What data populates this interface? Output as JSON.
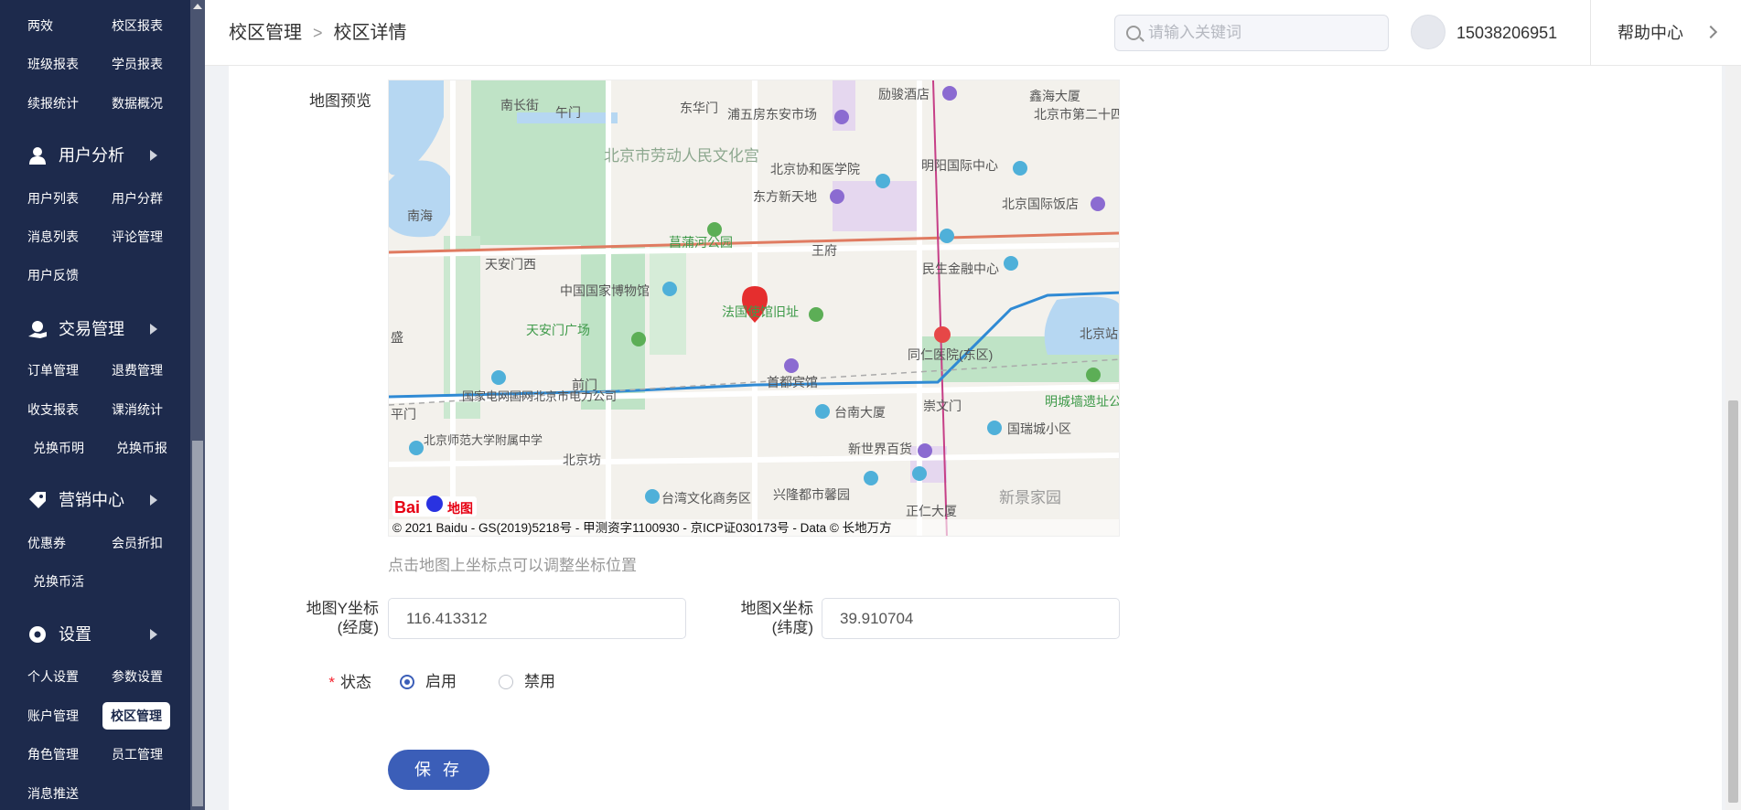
{
  "sidebar": {
    "top_items": [
      {
        "left": "两效",
        "right": "校区报表"
      },
      {
        "left": "班级报表",
        "right": "学员报表"
      },
      {
        "left": "续报统计",
        "right": "数据概况"
      }
    ],
    "groups": [
      {
        "label": "用户分析",
        "icon": "user-icon",
        "items": [
          [
            "用户列表",
            "用户分群"
          ],
          [
            "消息列表",
            "评论管理"
          ],
          [
            "用户反馈",
            ""
          ]
        ]
      },
      {
        "label": "交易管理",
        "icon": "money-icon",
        "items": [
          [
            "订单管理",
            "退费管理"
          ],
          [
            "收支报表",
            "课消统计"
          ],
          [
            "兑换币明",
            "兑换币报"
          ]
        ]
      },
      {
        "label": "营销中心",
        "icon": "tag-icon",
        "items": [
          [
            "优惠券",
            "会员折扣"
          ],
          [
            "兑换币活",
            ""
          ]
        ]
      },
      {
        "label": "设置",
        "icon": "gear-icon",
        "items": [
          [
            "个人设置",
            "参数设置"
          ],
          [
            "账户管理",
            "校区管理"
          ],
          [
            "角色管理",
            "员工管理"
          ],
          [
            "消息推送",
            ""
          ]
        ]
      }
    ],
    "active": "校区管理"
  },
  "header": {
    "breadcrumb": [
      "校区管理",
      "校区详情"
    ],
    "search_placeholder": "请输入关键词",
    "phone": "15038206951",
    "help": "帮助中心"
  },
  "form": {
    "map_label": "地图预览",
    "map": {
      "copyright": "© 2021 Baidu - GS(2019)5218号 - 甲测资字1100930 - 京ICP证030173号 - Data © 长地万方",
      "logo_text": "Bai",
      "logo_text2": "地图",
      "places": [
        "午门",
        "东华门",
        "南长街",
        "北京市劳动人民文化宫",
        "浦五房东安市场",
        "励骏酒店",
        "鑫海大厦",
        "北京市第二十四中学",
        "北京协和医学院",
        "明阳国际中心",
        "东方新天地",
        "北京国际饭店",
        "南海",
        "菖蒲河公园",
        "天安门西",
        "王府",
        "民生金融中心",
        "中国国家博物馆",
        "法国使馆旧址",
        "天安门广场",
        "同仁医院(东区)",
        "北京站",
        "国家电网国网北京市电力公司",
        "前门",
        "首都宾馆",
        "崇文门",
        "明城墙遗址公",
        "台南大厦",
        "国瑞城小区",
        "北京师范大学附属中学",
        "新世界百货",
        "北京坊",
        "台湾文化商务区",
        "兴隆都市馨园",
        "正仁大厦",
        "新景家园",
        "平门",
        "盛"
      ]
    },
    "map_hint": "点击地图上坐标点可以调整坐标位置",
    "lng_label": "地图Y坐标(经度)",
    "lng_label_line1": "地图Y坐标",
    "lng_label_line2": "(经度)",
    "lng_value": "116.413312",
    "lat_label_line1": "地图X坐标",
    "lat_label_line2": "(纬度)",
    "lat_value": "39.910704",
    "status_label": "状态",
    "status_options": [
      "启用",
      "禁用"
    ],
    "status_selected": "启用",
    "save_label": "保 存"
  },
  "colors": {
    "sidebar_bg": "#1d2a4c",
    "primary": "#3b5eb8",
    "required": "#f5222d"
  }
}
